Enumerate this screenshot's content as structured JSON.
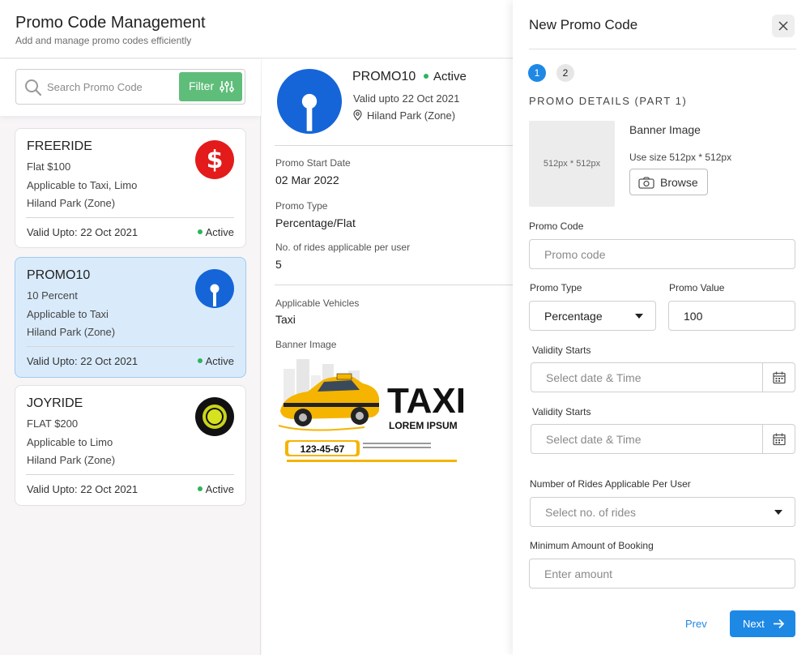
{
  "header": {
    "title": "Promo Code Management",
    "subtitle": "Add and manage promo codes efficiently"
  },
  "search": {
    "placeholder": "Search Promo Code",
    "filter_label": "Filter"
  },
  "promo_cards": [
    {
      "code": "FREERIDE",
      "value": "Flat $100",
      "applicable": "Applicable to Taxi, Limo",
      "zone": "Hiland Park (Zone)",
      "valid": "Valid Upto: 22 Oct 2021",
      "status": "Active",
      "logo": "dollar-logo-icon"
    },
    {
      "code": "PROMO10",
      "value": "10 Percent",
      "applicable": "Applicable to Taxi",
      "zone": "Hiland Park (Zone)",
      "valid": "Valid Upto: 22 Oct 2021",
      "status": "Active",
      "logo": "keyhole-logo-icon"
    },
    {
      "code": "JOYRIDE",
      "value": "FLAT $200",
      "applicable": "Applicable to Limo",
      "zone": "Hiland Park (Zone)",
      "valid": "Valid Upto: 22 Oct 2021",
      "status": "Active",
      "logo": "ring-logo-icon"
    }
  ],
  "detail": {
    "code": "PROMO10",
    "status": "Active",
    "valid": "Valid upto 22 Oct 2021",
    "location": "Hiland Park (Zone)",
    "start_label": "Promo Start Date",
    "start_value": "02 Mar 2022",
    "type_label": "Promo Type",
    "type_value": "Percentage/Flat",
    "rides_label": "No. of rides applicable per user",
    "rides_value": "5",
    "vehicles_label": "Applicable Vehicles",
    "vehicles_value": "Taxi",
    "banner_label": "Banner Image",
    "banner": {
      "headline": "TAXI",
      "tagline": "LOREM IPSUM",
      "phone": "123-45-67"
    }
  },
  "modal": {
    "title": "New Promo Code",
    "steps": [
      "1",
      "2"
    ],
    "section_title": "PROMO DETAILS (PART 1)",
    "image_placeholder": "512px * 512px",
    "banner_label": "Banner Image",
    "banner_hint": "Use size 512px * 512px",
    "browse_label": "Browse",
    "promo_code_label": "Promo Code",
    "promo_code_placeholder": "Promo code",
    "promo_type_label": "Promo Type",
    "promo_type_value": "Percentage",
    "promo_value_label": "Promo Value",
    "promo_value_value": "100",
    "validity_start_label": "Validity Starts",
    "validity_start_placeholder": "Select date & Time",
    "validity_end_label": "Validity Starts",
    "validity_end_placeholder": "Select date & Time",
    "rides_label": "Number of Rides Applicable Per User",
    "rides_placeholder": "Select no. of rides",
    "min_amount_label": "Minimum Amount of Booking",
    "min_amount_placeholder": "Enter amount",
    "prev_label": "Prev",
    "next_label": "Next"
  },
  "colors": {
    "accent": "#1e88e5",
    "filter_green": "#5fbd7a",
    "status_green": "#2fb35a",
    "selected_card": "#d9ebfb",
    "dollar_red": "#e31b1b"
  }
}
